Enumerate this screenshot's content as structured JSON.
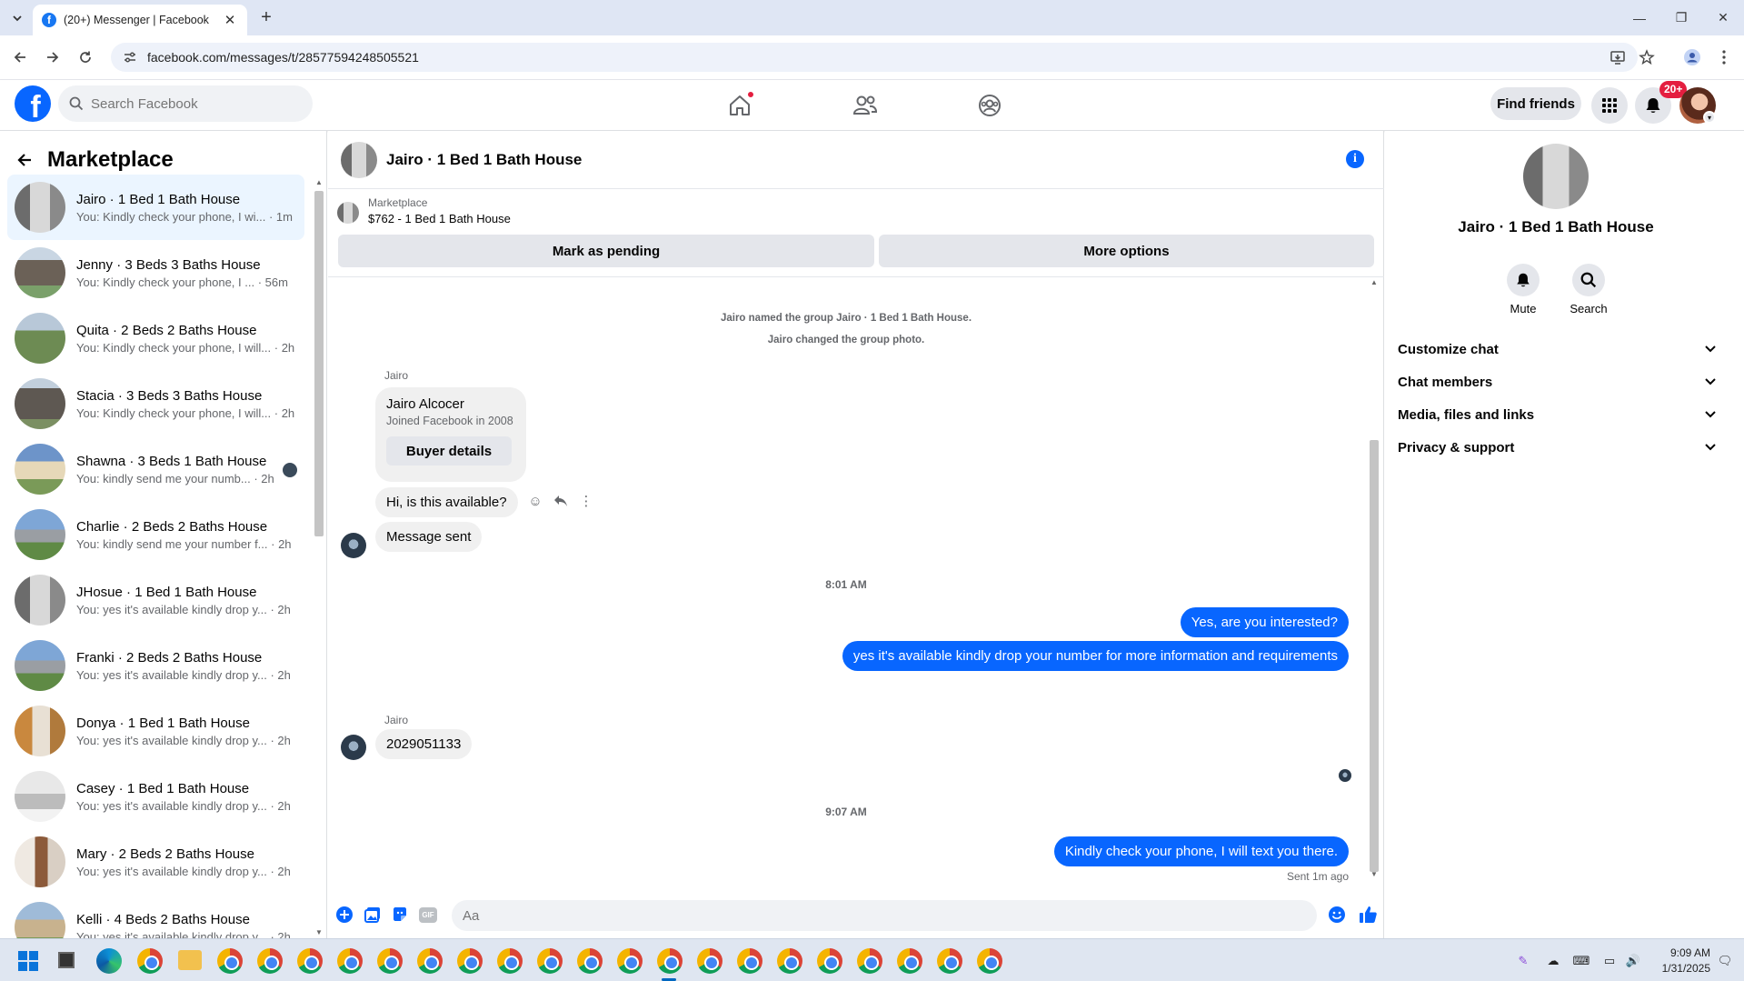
{
  "browser": {
    "tab_title": "(20+) Messenger | Facebook",
    "url": "facebook.com/messages/t/28577594248505521"
  },
  "header": {
    "search_placeholder": "Search Facebook",
    "find_friends": "Find friends",
    "notification_badge": "20+"
  },
  "sidebar": {
    "title": "Marketplace",
    "conversations": [
      {
        "name": "Jairo · 1 Bed 1 Bath House",
        "snippet": "You: Kindly check your phone, I wi... · 1m",
        "active": true
      },
      {
        "name": "Jenny · 3 Beds 3 Baths House",
        "snippet": "You: Kindly check your phone, I ... · 56m"
      },
      {
        "name": "Quita · 2 Beds 2 Baths House",
        "snippet": "You: Kindly check your phone, I will... · 2h"
      },
      {
        "name": "Stacia · 3 Beds 3 Baths House",
        "snippet": "You: Kindly check your phone, I will... · 2h"
      },
      {
        "name": "Shawna · 3 Beds 1 Bath House",
        "snippet": "You: kindly send me your numb... · 2h"
      },
      {
        "name": "Charlie · 2 Beds 2 Baths House",
        "snippet": "You: kindly send me your number f... · 2h"
      },
      {
        "name": "JHosue · 1 Bed 1 Bath House",
        "snippet": "You: yes it's available kindly drop y... · 2h"
      },
      {
        "name": "Franki · 2 Beds 2 Baths House",
        "snippet": "You: yes it's available kindly drop y... · 2h"
      },
      {
        "name": "Donya · 1 Bed 1 Bath House",
        "snippet": "You: yes it's available kindly drop y... · 2h"
      },
      {
        "name": "Casey · 1 Bed 1 Bath House",
        "snippet": "You: yes it's available kindly drop y... · 2h"
      },
      {
        "name": "Mary · 2 Beds 2 Baths House",
        "snippet": "You: yes it's available kindly drop y... · 2h"
      },
      {
        "name": "Kelli · 4 Beds 2 Baths House",
        "snippet": "You: yes it's available kindly drop y... · 2h"
      }
    ]
  },
  "chat": {
    "title": "Jairo · 1 Bed 1 Bath House",
    "marketplace_label": "Marketplace",
    "listing": "$762 - 1 Bed 1 Bath House",
    "mark_pending": "Mark as pending",
    "more_options": "More options",
    "system_1": "Jairo named the group Jairo · 1 Bed 1 Bath House.",
    "system_2": "Jairo changed the group photo.",
    "sender_1": "Jairo",
    "card_name": "Jairo Alcocer",
    "card_sub": "Joined Facebook in 2008",
    "card_button": "Buyer details",
    "msg_in_1": "Hi, is this available?",
    "msg_in_2": "Message sent",
    "time_1": "8:01 AM",
    "msg_out_1": "Yes, are you interested?",
    "msg_out_2": "yes it's available kindly drop your number for more information and requirements",
    "sender_2": "Jairo",
    "msg_in_3": "2029051133",
    "time_2": "9:07 AM",
    "msg_out_3": "Kindly check your phone, I will text you there.",
    "sent_status": "Sent 1m ago",
    "composer_placeholder": "Aa",
    "gif_label": "GIF"
  },
  "details": {
    "name": "Jairo · 1 Bed 1 Bath House",
    "mute": "Mute",
    "search": "Search",
    "sections": [
      "Customize chat",
      "Chat members",
      "Media, files and links",
      "Privacy & support"
    ]
  },
  "taskbar": {
    "time": "9:09 AM",
    "date": "1/31/2025"
  },
  "colors": {
    "accent": "#0866ff",
    "active_conv_bg": "#ebf5ff",
    "badge": "#e41e3f"
  }
}
